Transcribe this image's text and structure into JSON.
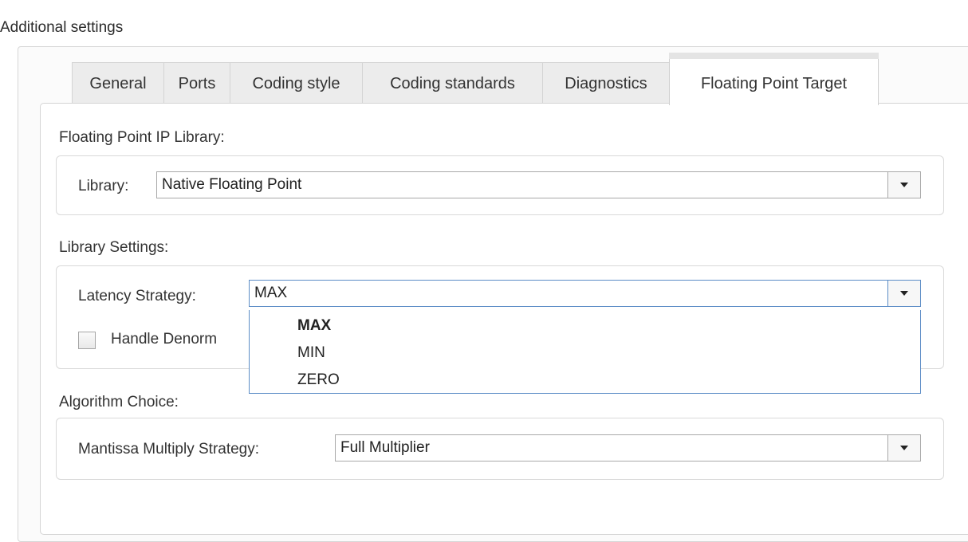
{
  "section": {
    "title": "Additional settings"
  },
  "tabs": [
    {
      "label": "General"
    },
    {
      "label": "Ports"
    },
    {
      "label": "Coding style"
    },
    {
      "label": "Coding standards"
    },
    {
      "label": "Diagnostics"
    },
    {
      "label": "Floating Point Target",
      "active": true
    }
  ],
  "ip_library": {
    "group_label": "Floating Point IP Library:",
    "library_label": "Library:",
    "library_value": "Native Floating Point"
  },
  "library_settings": {
    "group_label": "Library Settings:",
    "latency_label": "Latency Strategy:",
    "latency_value": "MAX",
    "latency_options": [
      "MAX",
      "MIN",
      "ZERO"
    ],
    "handle_denormals_label": "Handle Denorm",
    "handle_denormals_checked": false
  },
  "algorithm": {
    "group_label": "Algorithm Choice:",
    "mantissa_label": "Mantissa Multiply Strategy:",
    "mantissa_value": "Full Multiplier"
  },
  "colors": {
    "focus_border": "#5b8cc6",
    "tab_inactive_bg": "#ececec",
    "panel_border": "#d4d4d4"
  }
}
